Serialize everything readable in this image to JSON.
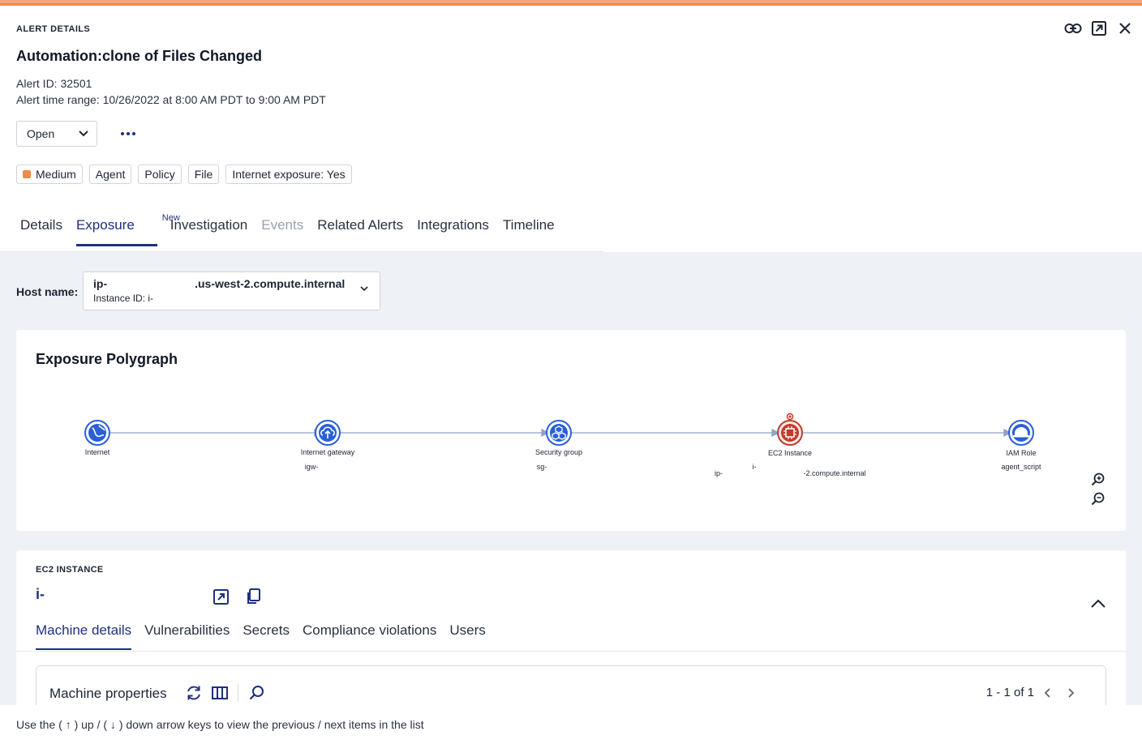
{
  "header": {
    "kicker": "ALERT DETAILS",
    "title": "Automation:clone of Files Changed",
    "alert_id": "Alert ID: 32501",
    "time_range": "Alert time range: 10/26/2022 at 8:00 AM PDT to 9:00 AM PDT",
    "icons": [
      "link-icon",
      "open-external-icon",
      "close-icon"
    ]
  },
  "status": {
    "selected": "Open"
  },
  "tags": [
    {
      "label": "Medium",
      "severity_color": "#f08a4b"
    },
    {
      "label": "Agent"
    },
    {
      "label": "Policy"
    },
    {
      "label": "File"
    },
    {
      "label": "Internet exposure: Yes"
    }
  ],
  "tabs": [
    {
      "label": "Details"
    },
    {
      "label": "Exposure",
      "badge": "New",
      "active": true
    },
    {
      "label": "Investigation"
    },
    {
      "label": "Events",
      "disabled": true
    },
    {
      "label": "Related Alerts"
    },
    {
      "label": "Integrations"
    },
    {
      "label": "Timeline"
    }
  ],
  "host": {
    "label": "Host name:",
    "name_prefix": "ip-",
    "name_suffix": ".us-west-2.compute.internal",
    "instance": "Instance ID: i-"
  },
  "polygraph": {
    "title": "Exposure Polygraph",
    "nodes": [
      {
        "label": "Internet",
        "sub": "",
        "icon": "globe-icon"
      },
      {
        "label": "Internet gateway",
        "sub": "igw-",
        "icon": "cloud-upload-icon"
      },
      {
        "label": "Security group",
        "sub": "sg-",
        "icon": "hexagons-icon"
      },
      {
        "label": "EC2 Instance",
        "sub": "",
        "icon": "cpu-chip-icon"
      },
      {
        "label": "IAM Role",
        "sub": "agent_script",
        "icon": "hard-hat-icon"
      }
    ],
    "ec2_details": {
      "ip": "ip-",
      "instance": "i-",
      "host": "-2.compute.internal"
    }
  },
  "ec2": {
    "kicker": "EC2 INSTANCE",
    "id": "i-",
    "tabs": [
      "Machine details",
      "Vulnerabilities",
      "Secrets",
      "Compliance violations",
      "Users"
    ]
  },
  "properties": {
    "title": "Machine properties",
    "pager": "1 - 1 of 1"
  },
  "footer": {
    "text": "Use the ( ↑ ) up / ( ↓ ) down arrow keys to view the previous / next items in the list"
  },
  "colors": {
    "accent": "#1f2f80",
    "node_blue": "#2a5fd6",
    "alert_red": "#c23a2b",
    "top_bar": "#ef8a4f"
  }
}
